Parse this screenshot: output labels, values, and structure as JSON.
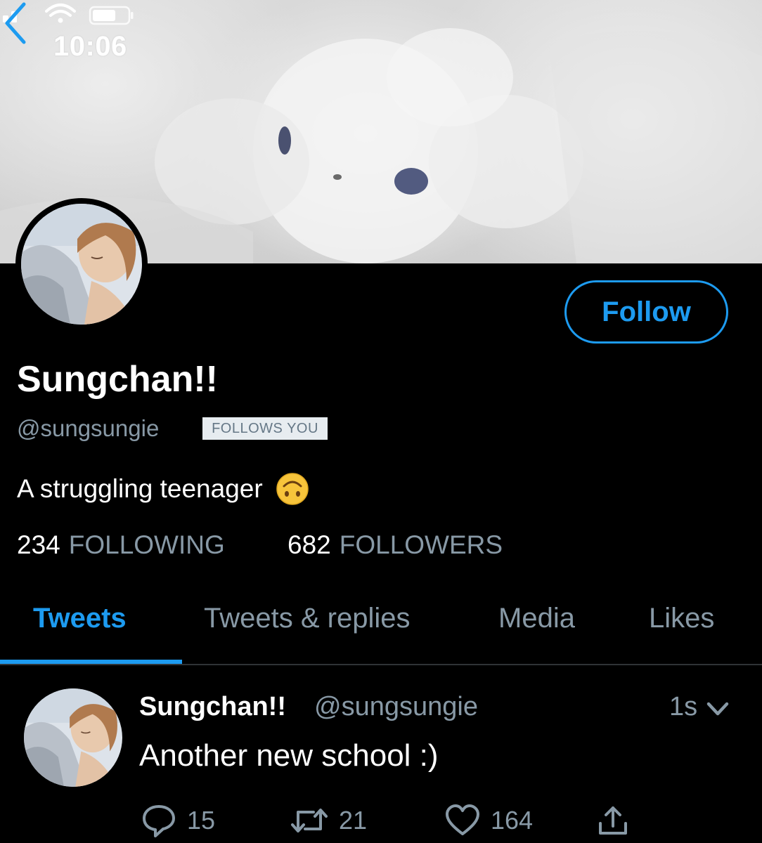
{
  "status_bar": {
    "time": "10:06"
  },
  "profile": {
    "display_name": "Sungchan!!",
    "handle": "@sungsungie",
    "follows_you_badge": "FOLLOWS YOU",
    "bio": "A struggling teenager",
    "bio_emoji": "upside-down-face-icon",
    "follow_label": "Follow"
  },
  "stats": {
    "following_count": "234",
    "following_label": "FOLLOWING",
    "followers_count": "682",
    "followers_label": "FOLLOWERS"
  },
  "tabs": [
    {
      "label": "Tweets",
      "active": true
    },
    {
      "label": "Tweets & replies",
      "active": false
    },
    {
      "label": "Media",
      "active": false
    },
    {
      "label": "Likes",
      "active": false
    }
  ],
  "tweet": {
    "name": "Sungchan!!",
    "handle": "@sungsungie",
    "time": "1s",
    "text": "Another new school :)",
    "replies": "15",
    "retweets": "21",
    "likes": "164"
  },
  "colors": {
    "accent": "#1d9bf0",
    "muted": "#8899a6",
    "background": "#000000"
  }
}
